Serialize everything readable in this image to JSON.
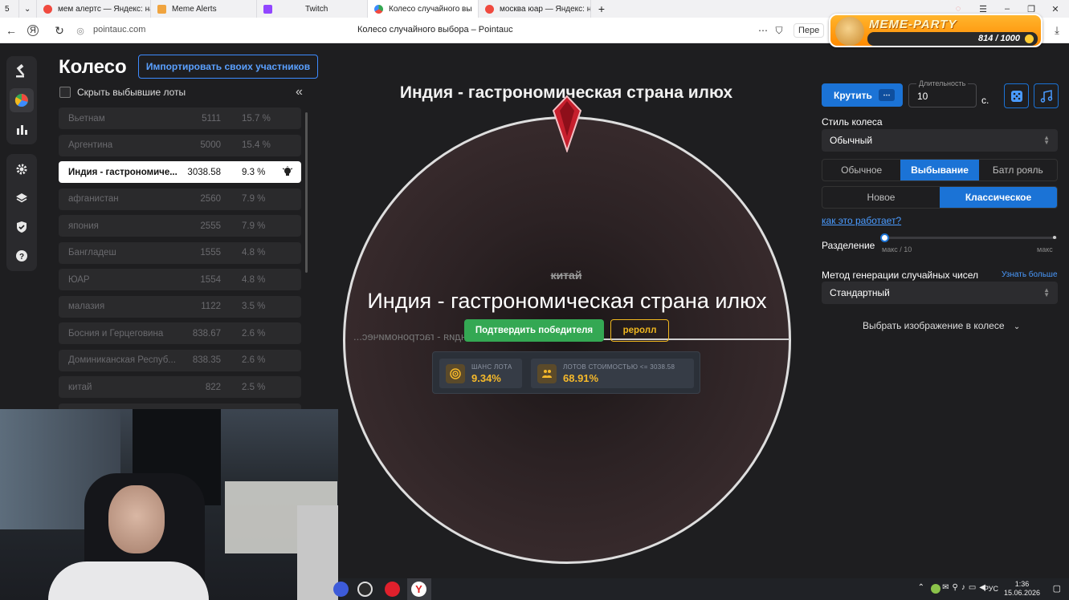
{
  "browser": {
    "tabs": [
      {
        "label": "мем алертс — Яндекс: на",
        "color": "#f04a3f"
      },
      {
        "label": "Meme Alerts",
        "color": "#f0a43f"
      },
      {
        "label": "Twitch",
        "color": "#9146ff"
      },
      {
        "label": "Колесо случайного вы",
        "color": "#34a853"
      },
      {
        "label": "москва юар — Яндекс: на",
        "color": "#f04a3f"
      }
    ],
    "tab_count": "5",
    "url": "pointauc.com",
    "page_title": "Колесо случайного выбора – Pointauc",
    "translate_hint": "Пере"
  },
  "meme_party": {
    "title": "MEME-PARTY",
    "count": "814 / 1000"
  },
  "lots_panel": {
    "heading": "Колесо",
    "import_button": "Импортировать своих участников",
    "hide_label": "Скрыть выбывшие лоты",
    "collapse": "«",
    "lots": [
      {
        "name": "Вьетнам",
        "value": "5111",
        "percent": "15.7 %",
        "state": "out"
      },
      {
        "name": "Аргентина",
        "value": "5000",
        "percent": "15.4 %",
        "state": "out"
      },
      {
        "name": "Индия - гастрономиче...",
        "value": "3038.58",
        "percent": "9.3 %",
        "state": "current"
      },
      {
        "name": "афганистан",
        "value": "2560",
        "percent": "7.9 %",
        "state": "out"
      },
      {
        "name": "япония",
        "value": "2555",
        "percent": "7.9 %",
        "state": "out"
      },
      {
        "name": "Бангладеш",
        "value": "1555",
        "percent": "4.8 %",
        "state": "out"
      },
      {
        "name": "ЮАР",
        "value": "1554",
        "percent": "4.8 %",
        "state": "out"
      },
      {
        "name": "малазия",
        "value": "1122",
        "percent": "3.5 %",
        "state": "out"
      },
      {
        "name": "Босния и Герцеговина",
        "value": "838.67",
        "percent": "2.6 %",
        "state": "out"
      },
      {
        "name": "Доминиканская Респуб...",
        "value": "838.35",
        "percent": "2.6 %",
        "state": "out"
      },
      {
        "name": "китай",
        "value": "822",
        "percent": "2.5 %",
        "state": "out"
      },
      {
        "name": "",
        "value": "",
        "percent": "",
        "state": "out"
      }
    ]
  },
  "wheel": {
    "winner_heading": "Индия - гастрономическая страна илюх",
    "eliminated_label": "китай",
    "winner_on_wheel": "Индия - гастрономическая страна илюх",
    "mirrored_label": "Индия - гастрономичес...",
    "confirm_button": "Подтвердить победителя",
    "reroll_button": "реролл",
    "stats": [
      {
        "label": "ШАНС ЛОТА",
        "value": "9.34%"
      },
      {
        "label": "ЛОТОВ СТОИМОСТЬЮ <= 3038.58",
        "value": "68.91%"
      }
    ]
  },
  "settings": {
    "spin_button": "Крутить",
    "duration_label": "Длительность",
    "duration_value": "10",
    "seconds_unit": "с.",
    "style_label": "Стиль колеса",
    "style_value": "Обычный",
    "mode_tabs": [
      {
        "label": "Обычное",
        "active": false
      },
      {
        "label": "Выбывание",
        "active": true
      },
      {
        "label": "Батл рояль",
        "active": false
      }
    ],
    "elimination_tabs": [
      {
        "label": "Новое",
        "active": false
      },
      {
        "label": "Классическое",
        "active": true
      }
    ],
    "how_link": "как это работает?",
    "split_label": "Разделение",
    "split_min": "макс / 10",
    "split_max": "макс",
    "split_level": 0,
    "rng_label": "Метод генерации случайных чисел",
    "rng_more": "Узнать больше",
    "rng_value": "Стандартный",
    "choose_image": "Выбрать изображение в колесе"
  },
  "taskbar": {
    "lang": "РУС",
    "time": "1:36",
    "date": "15.06.2026"
  }
}
